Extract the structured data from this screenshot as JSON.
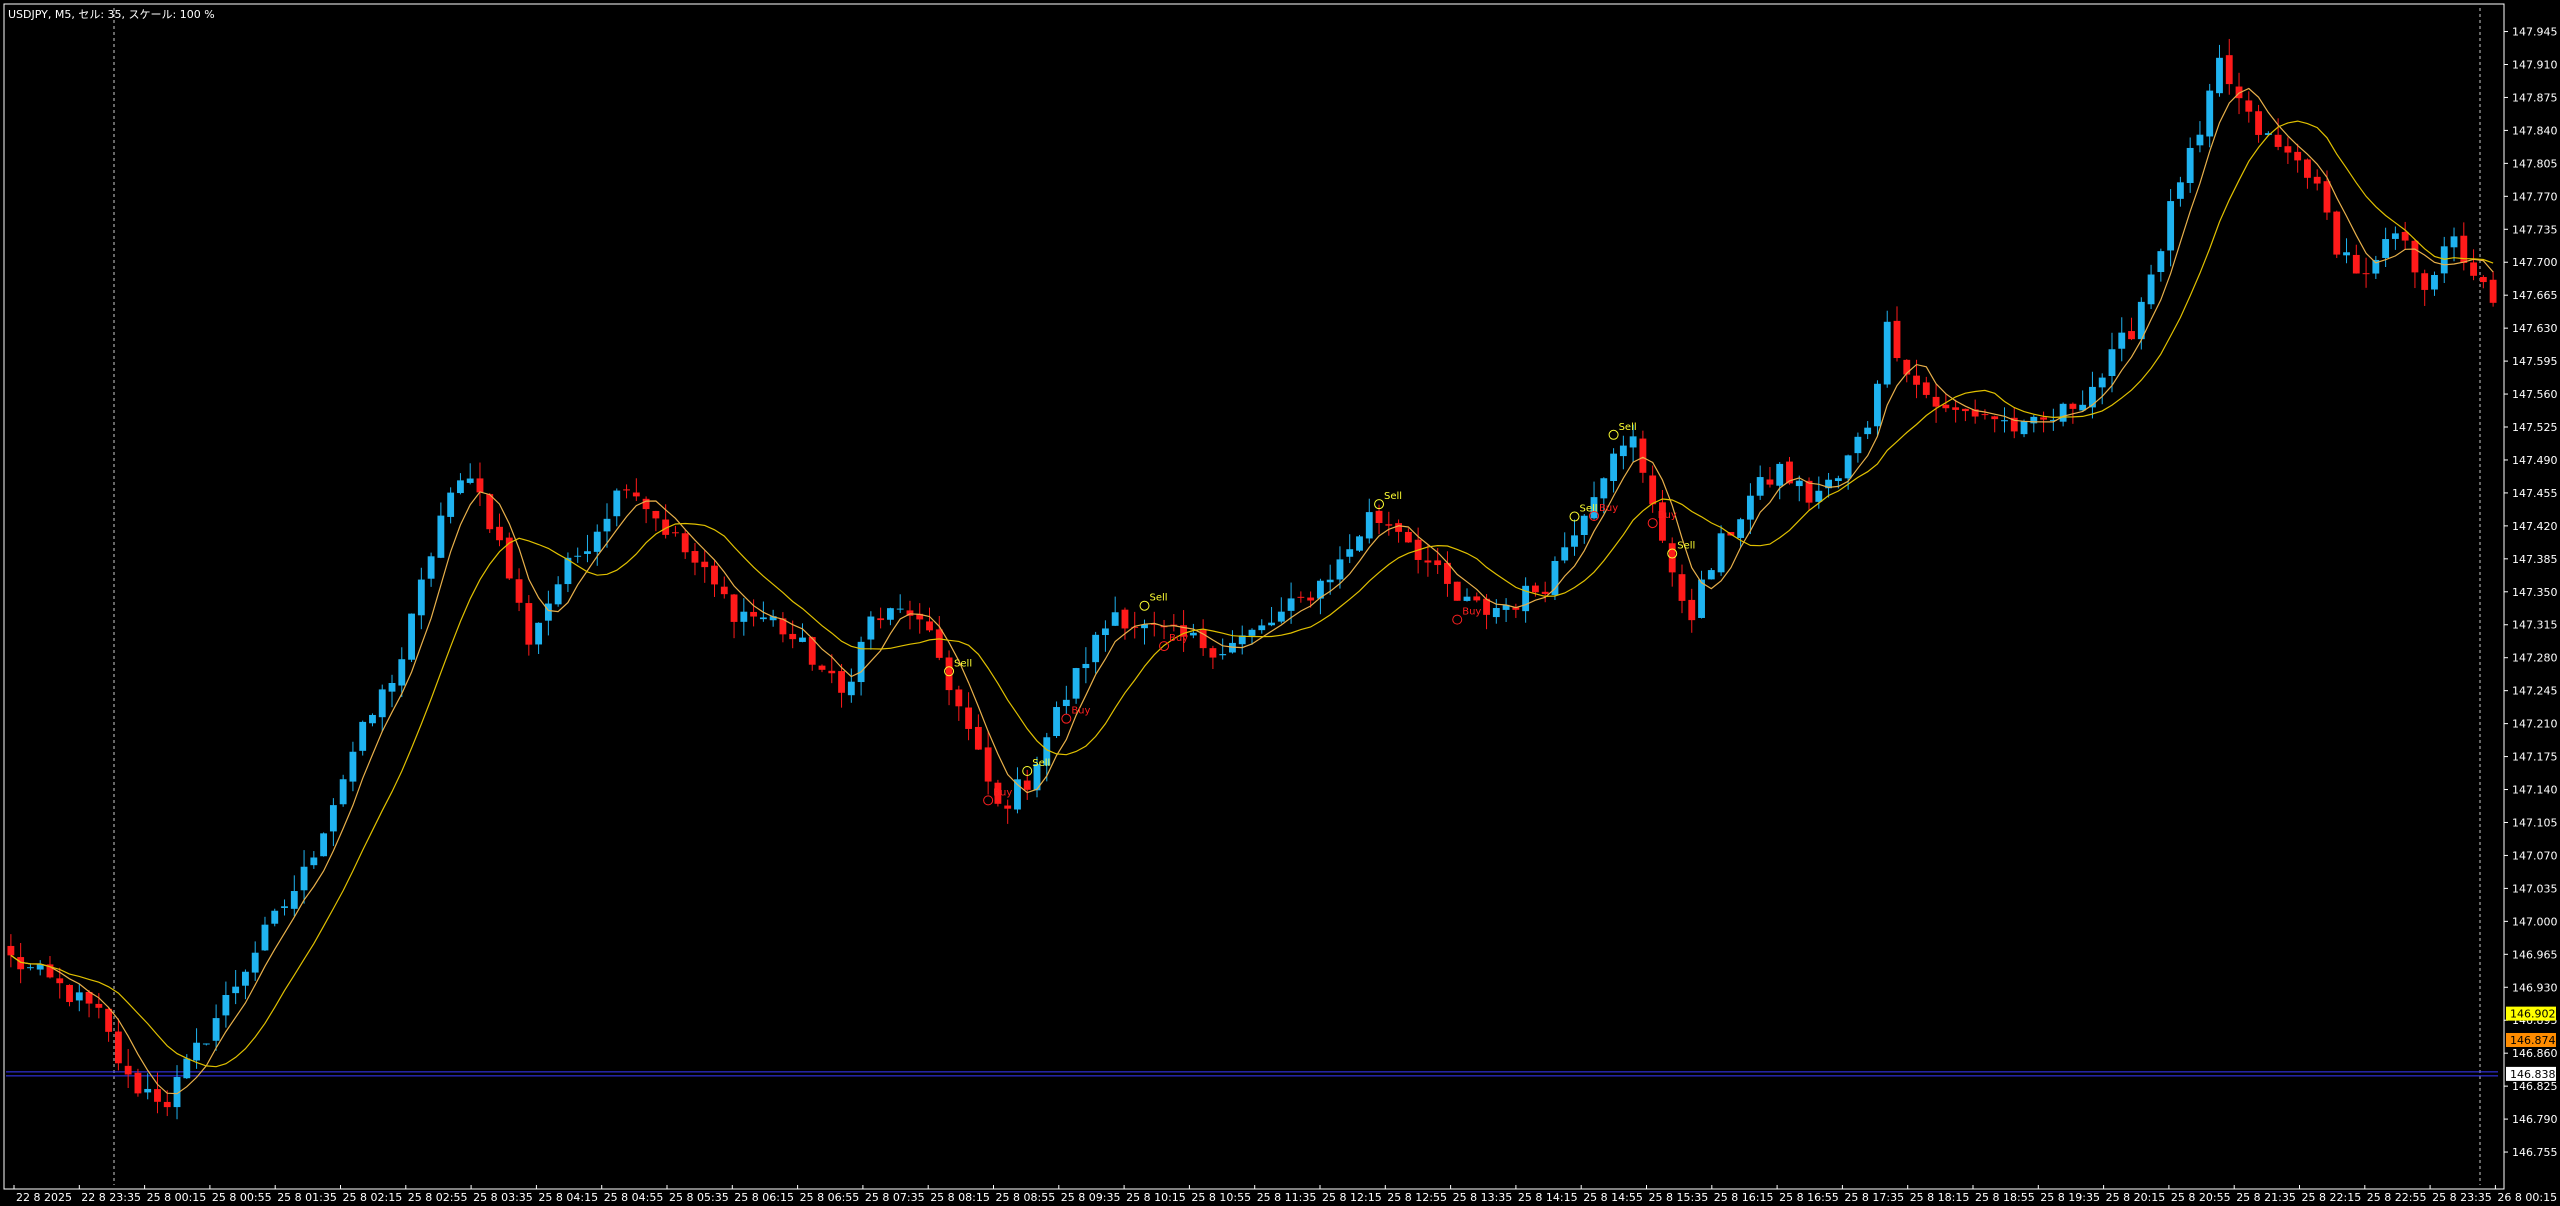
{
  "header": {
    "title": "USDJPY, M5, セル: 35, スケール: 100 %"
  },
  "colors": {
    "background": "#000000",
    "bull": "#1fb3f0",
    "bear": "#ff1a1a",
    "ma_fast": "#e8b04a",
    "ma_slow": "#e0c000",
    "signal_sell": "#ffff33",
    "signal_buy": "#ff2020",
    "grid": "#ffffff",
    "axis_text": "#ffffff",
    "hline": "#3a3aff",
    "price_label_yellow": "#ffff00",
    "price_label_orange": "#ff8c00"
  },
  "chart_data": {
    "type": "candlestick",
    "symbol": "USDJPY",
    "timeframe": "M5",
    "ylim": [
      146.72,
      147.97
    ],
    "yticks": [
      "147.945",
      "147.910",
      "147.875",
      "147.840",
      "147.805",
      "147.770",
      "147.735",
      "147.700",
      "147.665",
      "147.630",
      "147.595",
      "147.560",
      "147.525",
      "147.490",
      "147.455",
      "147.420",
      "147.385",
      "147.350",
      "147.315",
      "147.280",
      "147.245",
      "147.210",
      "147.175",
      "147.140",
      "147.105",
      "147.070",
      "147.035",
      "147.000",
      "146.965",
      "146.930",
      "146.895",
      "146.860",
      "146.825",
      "146.790",
      "146.755"
    ],
    "xticks": [
      "22 8 2025",
      "22 8 23:35",
      "25 8 00:15",
      "25 8 00:55",
      "25 8 01:35",
      "25 8 02:15",
      "25 8 02:55",
      "25 8 03:35",
      "25 8 04:15",
      "25 8 04:55",
      "25 8 05:35",
      "25 8 06:15",
      "25 8 06:55",
      "25 8 07:35",
      "25 8 08:15",
      "25 8 08:55",
      "25 8 09:35",
      "25 8 10:15",
      "25 8 10:55",
      "25 8 11:35",
      "25 8 12:15",
      "25 8 12:55",
      "25 8 13:35",
      "25 8 14:15",
      "25 8 14:55",
      "25 8 15:35",
      "25 8 16:15",
      "25 8 16:55",
      "25 8 17:35",
      "25 8 18:15",
      "25 8 18:55",
      "25 8 19:35",
      "25 8 20:15",
      "25 8 20:55",
      "25 8 21:35",
      "25 8 22:15",
      "25 8 22:55",
      "25 8 23:35",
      "26 8 00:15"
    ],
    "price_labels": [
      {
        "value": "146.902",
        "style": "yellow"
      },
      {
        "value": "146.874",
        "style": "orange"
      },
      {
        "value": "146.838",
        "style": "white"
      }
    ],
    "horizontal_line": 146.838,
    "anchors": [
      [
        0,
        146.96
      ],
      [
        5,
        146.93
      ],
      [
        9,
        146.9
      ],
      [
        12,
        146.83
      ],
      [
        16,
        146.81
      ],
      [
        20,
        146.88
      ],
      [
        25,
        146.97
      ],
      [
        30,
        147.05
      ],
      [
        35,
        147.18
      ],
      [
        40,
        147.28
      ],
      [
        44,
        147.43
      ],
      [
        47,
        147.48
      ],
      [
        50,
        147.4
      ],
      [
        53,
        147.3
      ],
      [
        56,
        147.36
      ],
      [
        60,
        147.42
      ],
      [
        63,
        147.47
      ],
      [
        66,
        147.43
      ],
      [
        70,
        147.38
      ],
      [
        74,
        147.33
      ],
      [
        78,
        147.32
      ],
      [
        82,
        147.28
      ],
      [
        85,
        147.24
      ],
      [
        88,
        147.32
      ],
      [
        92,
        147.33
      ],
      [
        95,
        147.28
      ],
      [
        98,
        147.2
      ],
      [
        101,
        147.12
      ],
      [
        104,
        147.15
      ],
      [
        107,
        147.22
      ],
      [
        110,
        147.28
      ],
      [
        113,
        147.33
      ],
      [
        116,
        147.31
      ],
      [
        120,
        147.3
      ],
      [
        124,
        147.29
      ],
      [
        128,
        147.31
      ],
      [
        132,
        147.34
      ],
      [
        136,
        147.38
      ],
      [
        139,
        147.43
      ],
      [
        142,
        147.42
      ],
      [
        145,
        147.38
      ],
      [
        148,
        147.34
      ],
      [
        151,
        147.33
      ],
      [
        154,
        147.34
      ],
      [
        157,
        147.36
      ],
      [
        160,
        147.42
      ],
      [
        163,
        147.48
      ],
      [
        166,
        147.51
      ],
      [
        168,
        147.45
      ],
      [
        170,
        147.36
      ],
      [
        172,
        147.33
      ],
      [
        175,
        147.4
      ],
      [
        178,
        147.45
      ],
      [
        181,
        147.48
      ],
      [
        184,
        147.45
      ],
      [
        187,
        147.47
      ],
      [
        190,
        147.53
      ],
      [
        192,
        147.63
      ],
      [
        195,
        147.57
      ],
      [
        198,
        147.54
      ],
      [
        202,
        147.54
      ],
      [
        206,
        147.52
      ],
      [
        210,
        147.54
      ],
      [
        214,
        147.58
      ],
      [
        217,
        147.63
      ],
      [
        220,
        147.72
      ],
      [
        222,
        147.79
      ],
      [
        224,
        147.83
      ],
      [
        226,
        147.91
      ],
      [
        229,
        147.85
      ],
      [
        232,
        147.82
      ],
      [
        235,
        147.8
      ],
      [
        238,
        147.72
      ],
      [
        241,
        147.68
      ],
      [
        244,
        147.73
      ],
      [
        247,
        147.68
      ],
      [
        250,
        147.72
      ],
      [
        252,
        147.69
      ],
      [
        254,
        147.65
      ]
    ],
    "n_bars": 255,
    "ma_fast_period": 5,
    "ma_slow_period": 12,
    "signal_labels": [
      "Sell",
      "Buy"
    ]
  }
}
